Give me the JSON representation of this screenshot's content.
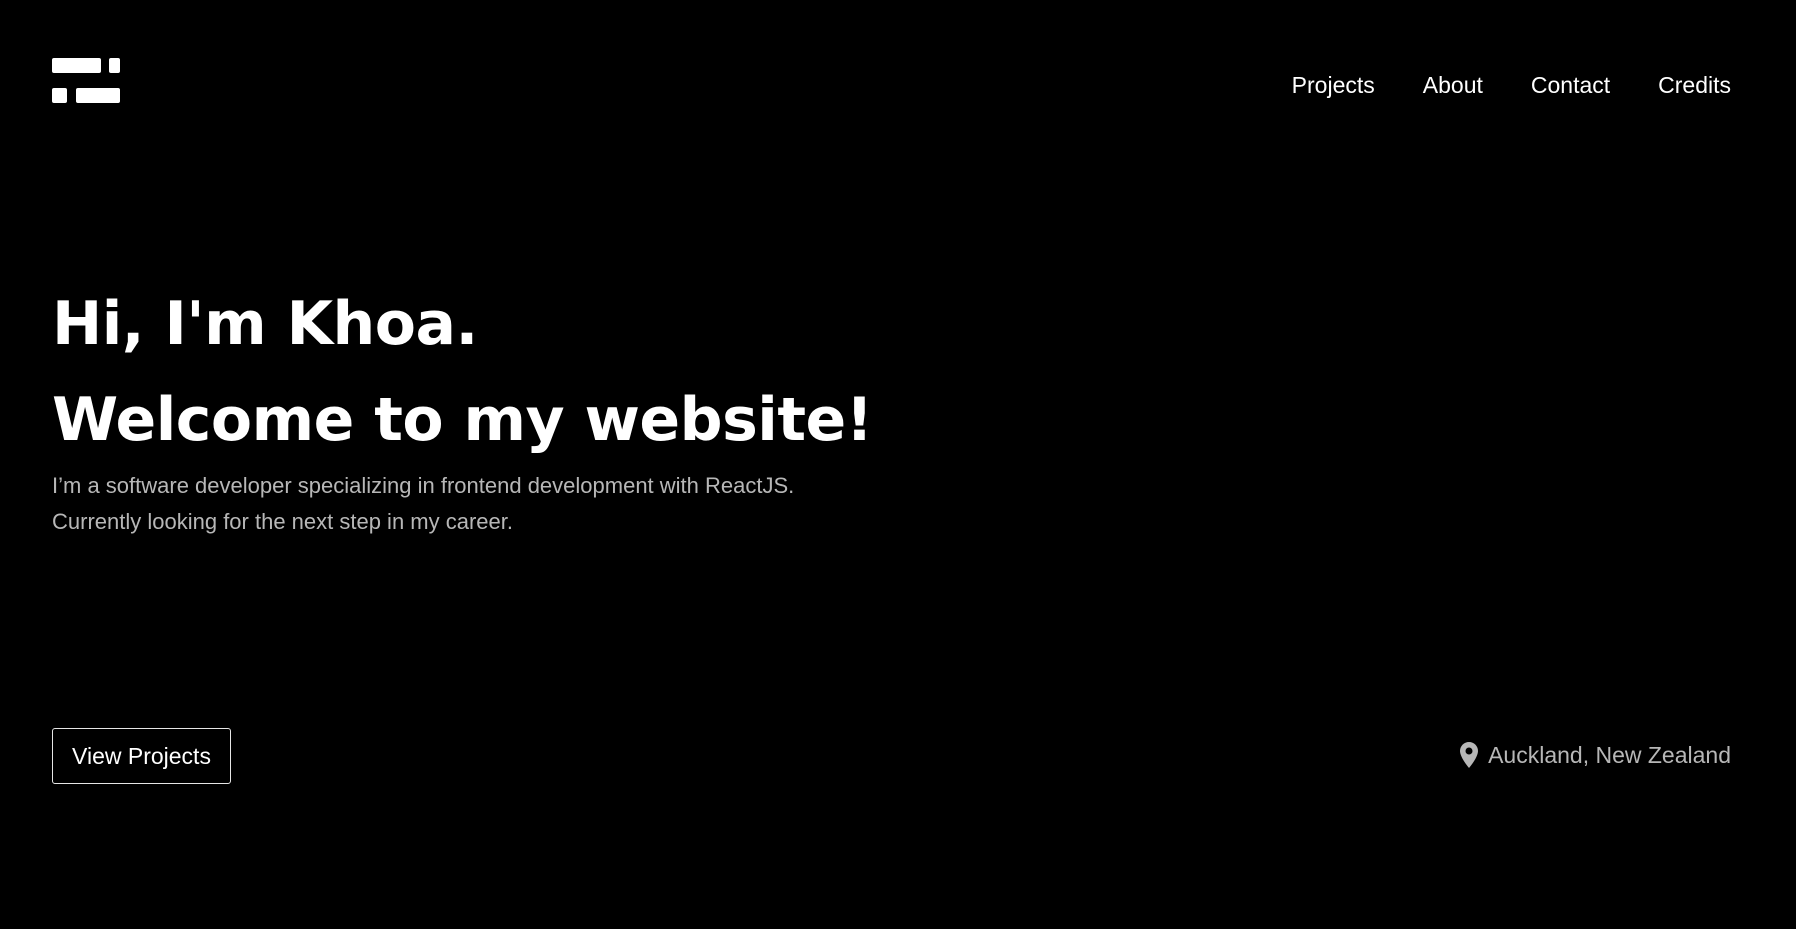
{
  "logo": {
    "icon": "brick-logo-icon",
    "color": "#ffffff"
  },
  "nav": {
    "items": [
      {
        "label": "Projects"
      },
      {
        "label": "About"
      },
      {
        "label": "Contact"
      },
      {
        "label": "Credits"
      }
    ]
  },
  "hero": {
    "greeting": "Hi, I'm Khoa.",
    "welcome": "Welcome to my website!",
    "intro_line1": "I’m a software developer specializing in frontend development with ReactJS.",
    "intro_line2": "Currently looking for the next step in my career."
  },
  "cta": {
    "label": "View Projects"
  },
  "location": {
    "icon": "map-pin-icon",
    "text": "Auckland, New Zealand"
  },
  "colors": {
    "background": "#000000",
    "text": "#ffffff",
    "muted": "#b7b7b7"
  }
}
